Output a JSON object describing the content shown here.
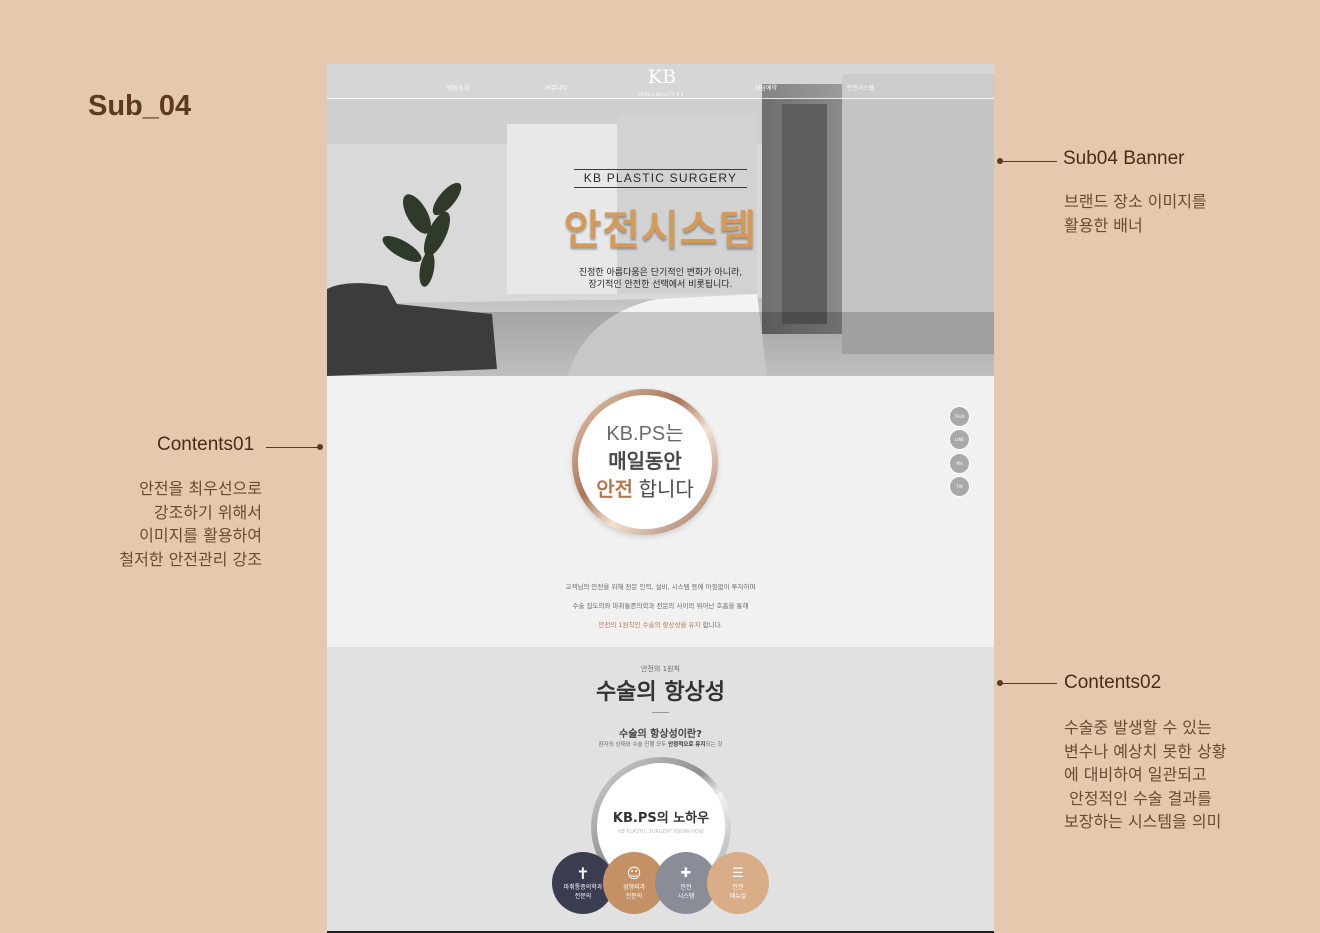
{
  "page": {
    "title": "Sub_04"
  },
  "annotations": {
    "banner": {
      "title": "Sub04 Banner",
      "desc": [
        "브랜드 장소 이미지를",
        "활용한 배너"
      ]
    },
    "contents01": {
      "title": "Contents01",
      "desc": [
        "안전을 최우선으로",
        "강조하기 위해서",
        "이미지를 활용하여",
        "철저한 안전관리 강조"
      ]
    },
    "contents02": {
      "title": "Contents02",
      "desc": [
        "수술중 발생할 수 있는",
        "변수나 예상치 못한 상황",
        "에 대비하여 일관되고",
        " 안정적인 수술 결과를",
        "보장하는 시스템을 의미"
      ]
    }
  },
  "mockup": {
    "nav": {
      "items": [
        "병원소개",
        "커뮤니티",
        "상담예약",
        "안전시스템"
      ],
      "logo": "KB",
      "logo_sub": "KOREA BEAUTY P.S"
    },
    "banner": {
      "eyebrow": "KB PLASTIC SURGERY",
      "headline": "안전시스템",
      "copy": [
        "진정한 아름다움은 단기적인 변화가 아니라,",
        "장기적인 안전한 선택에서 비롯됩니다."
      ]
    },
    "sns": [
      "TALK",
      "LINE",
      "WA",
      "TW"
    ],
    "circle": {
      "line1": "KB.PS는",
      "line2": "매일동안",
      "line3_accent": "안전",
      "line3_rest": " 합니다"
    },
    "c1_text": {
      "p1": "고객님의 안전을 위해 전문 인력, 설비, 시스템 등에 아낌없이 투자하며",
      "p2": "수술 집도의와 마취통증의학과 전문의 사이의 뛰어난 호흡을 통해",
      "p3_accent": "안전의 1원칙인 수술의 항상성을 유지",
      "p3_rest": " 합니다."
    },
    "c2": {
      "eyebrow": "안전의 1원칙",
      "title": "수술의 항상성",
      "q": "수술의 항상성이란?",
      "q_desc_a": "환자의 상태와 수술 진행 모두 ",
      "q_desc_b": "안정적으로 유지",
      "q_desc_c": "되는 것",
      "knowhow": "KB.PS의 노하우",
      "knowhow_sub": "KB PLASTIC SURGERY KNOW-HOW",
      "items": [
        {
          "l1": "마취통증의학과",
          "l2": "전문의",
          "icon": "syringe-icon"
        },
        {
          "l1": "성형외과",
          "l2": "전문의",
          "icon": "doctor-icon"
        },
        {
          "l1": "안전",
          "l2": "시스템",
          "icon": "ambulance-icon"
        },
        {
          "l1": "안전",
          "l2": "매뉴얼",
          "icon": "clipboard-icon"
        }
      ]
    }
  },
  "colors": {
    "background": "#e4c9ae",
    "accent": "#c49066",
    "dark_brown": "#5a3a20",
    "navy": "#3a3d4f"
  }
}
